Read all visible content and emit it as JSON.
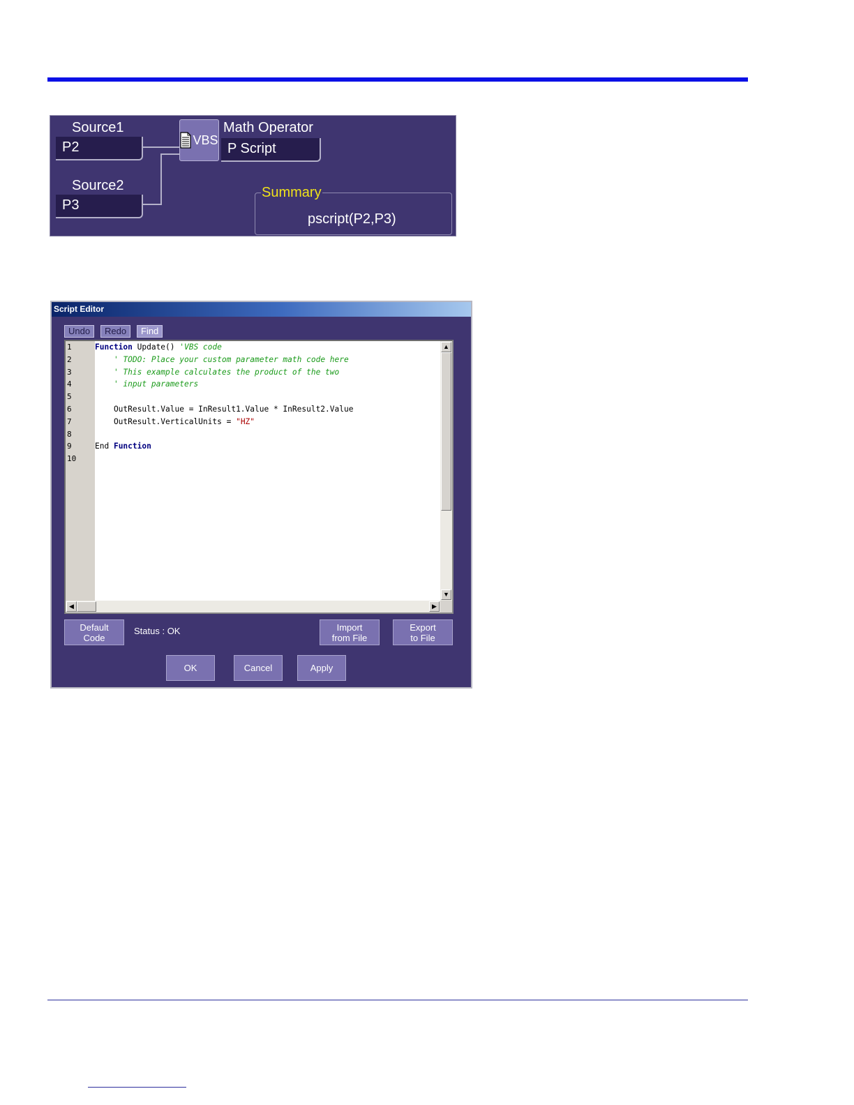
{
  "math_panel": {
    "source1_label": "Source1",
    "source1_value": "P2",
    "source2_label": "Source2",
    "source2_value": "P3",
    "vbs_label": "VBS",
    "operator_label": "Math Operator",
    "operator_value": "P Script",
    "summary_label": "Summary",
    "summary_value": "pscript(P2,P3)"
  },
  "dialog": {
    "title": "Script Editor",
    "toolbar": {
      "undo": "Undo",
      "redo": "Redo",
      "find": "Find"
    },
    "line_numbers": [
      "1",
      "2",
      "3",
      "4",
      "5",
      "6",
      "7",
      "8",
      "9",
      "10"
    ],
    "code_lines": [
      [
        {
          "t": "Function",
          "c": "kw"
        },
        {
          "t": " Update() ",
          "c": ""
        },
        {
          "t": "'VBS code",
          "c": "cm"
        }
      ],
      [
        {
          "t": "    ",
          "c": ""
        },
        {
          "t": "' TODO: Place your custom parameter math code here",
          "c": "cm"
        }
      ],
      [
        {
          "t": "    ",
          "c": ""
        },
        {
          "t": "' This example calculates the product of the two",
          "c": "cm"
        }
      ],
      [
        {
          "t": "    ",
          "c": ""
        },
        {
          "t": "' input parameters",
          "c": "cm"
        }
      ],
      [],
      [
        {
          "t": "    OutResult.Value = InResult1.Value * InResult2.Value",
          "c": ""
        }
      ],
      [
        {
          "t": "    OutResult.VerticalUnits = ",
          "c": ""
        },
        {
          "t": "\"HZ\"",
          "c": "st"
        }
      ],
      [],
      [
        {
          "t": "End ",
          "c": ""
        },
        {
          "t": "Function",
          "c": "kw"
        }
      ],
      []
    ],
    "default_code": "Default\nCode",
    "status": "Status : OK",
    "import": "Import\nfrom File",
    "export": "Export\nto File",
    "ok": "OK",
    "cancel": "Cancel",
    "apply": "Apply"
  }
}
